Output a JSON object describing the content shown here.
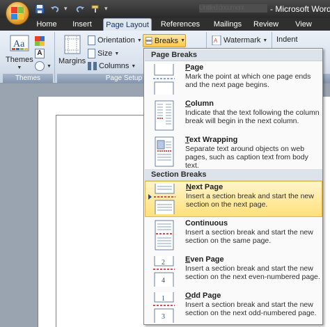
{
  "window": {
    "doc_title": "Untitled document",
    "app_title": "Microsoft Word"
  },
  "quick_access": {
    "save_icon": "save-icon",
    "undo_icon": "undo-icon",
    "redo_icon": "redo-icon",
    "format_icon": "format-painter-icon"
  },
  "tabs": [
    {
      "label": "Home"
    },
    {
      "label": "Insert"
    },
    {
      "label": "Page Layout"
    },
    {
      "label": "References"
    },
    {
      "label": "Mailings"
    },
    {
      "label": "Review"
    },
    {
      "label": "View"
    }
  ],
  "ribbon": {
    "themes_label": "Themes",
    "themes_group": "Themes",
    "margins_label": "Margins",
    "orientation_label": "Orientation",
    "size_label": "Size",
    "columns_label": "Columns",
    "breaks_label": "Breaks",
    "page_setup_group": "Page Setup",
    "watermark_label": "Watermark",
    "indent_label": "Indent"
  },
  "menu": {
    "page_breaks_header": "Page Breaks",
    "section_breaks_header": "Section Breaks",
    "page_breaks": [
      {
        "title": "Page",
        "underline": "P",
        "rest": "age",
        "desc": "Mark the point at which one page ends and the next page begins."
      },
      {
        "title": "Column",
        "underline": "C",
        "rest": "olumn",
        "desc": "Indicate that the text following the column break will begin in the next column."
      },
      {
        "title": "Text Wrapping",
        "underline": "T",
        "rest": "ext Wrapping",
        "desc": "Separate text around objects on web pages, such as caption text from body text."
      }
    ],
    "section_breaks": [
      {
        "title": "Next Page",
        "underline": "N",
        "rest": "ext Page",
        "desc": "Insert a section break and start the new section on the next page."
      },
      {
        "title": "Continuous",
        "underline": "",
        "rest": "Continuous",
        "desc": "Insert a section break and start the new section on the same page."
      },
      {
        "title": "Even Page",
        "underline": "E",
        "rest": "ven Page",
        "desc": "Insert a section break and start the new section on the next even-numbered page."
      },
      {
        "title": "Odd Page",
        "underline": "O",
        "rest": "dd Page",
        "desc": "Insert a section break and start the new section on the next odd-numbered page."
      }
    ]
  },
  "colors": {
    "accent": "#ffc84a",
    "menu_header": "#dde3ea",
    "selected": "#ffe07a"
  }
}
